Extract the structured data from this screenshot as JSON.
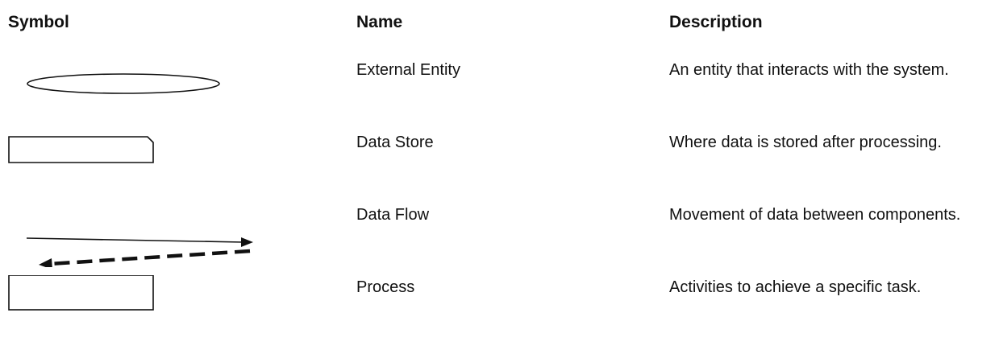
{
  "table": {
    "headers": {
      "symbol": "Symbol",
      "name": "Name",
      "description": "Description"
    },
    "rows": [
      {
        "symbol_icon": "ellipse-icon",
        "name": "External Entity",
        "description": "An entity that interacts with the system."
      },
      {
        "symbol_icon": "notched-rectangle-icon",
        "name": "Data Store",
        "description": "Where data is stored after processing."
      },
      {
        "symbol_icon": "bidirectional-arrows-icon",
        "name": "Data Flow",
        "description": "Movement of data between components."
      },
      {
        "symbol_icon": "rectangle-icon",
        "name": "Process",
        "description": "Activities to achieve a specific task."
      }
    ]
  }
}
